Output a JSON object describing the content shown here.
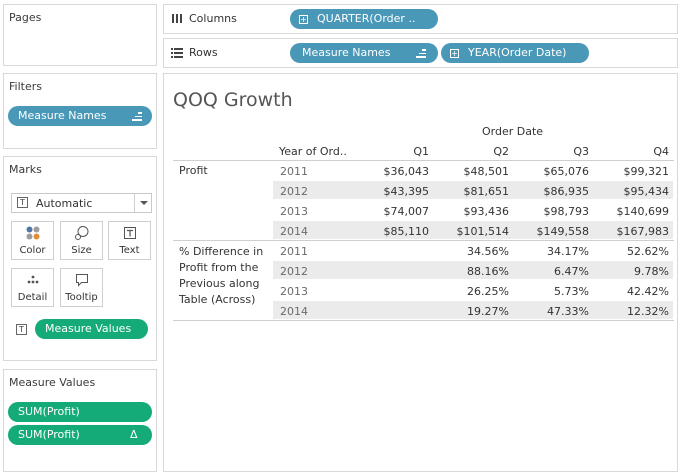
{
  "pages": {
    "title": "Pages"
  },
  "filters": {
    "title": "Filters",
    "pill": "Measure Names"
  },
  "marks": {
    "title": "Marks",
    "mark_type": "Automatic",
    "buttons": [
      {
        "label": "Color",
        "icon": "color-dots-icon"
      },
      {
        "label": "Size",
        "icon": "size-icon"
      },
      {
        "label": "Text",
        "icon": "text-icon"
      },
      {
        "label": "Detail",
        "icon": "detail-icon"
      },
      {
        "label": "Tooltip",
        "icon": "tooltip-icon"
      }
    ],
    "text_pill": "Measure Values"
  },
  "measure_values": {
    "title": "Measure Values",
    "items": [
      {
        "label": "SUM(Profit)",
        "delta": ""
      },
      {
        "label": "SUM(Profit)",
        "delta": "Δ"
      }
    ]
  },
  "columns": {
    "label": "Columns",
    "pill": "QUARTER(Order .."
  },
  "rows": {
    "label": "Rows",
    "pills": [
      "Measure Names",
      "YEAR(Order Date)"
    ]
  },
  "view": {
    "title": "QOQ Growth",
    "order_date_header": "Order Date",
    "year_header": "Year of Ord..",
    "quarters": [
      "Q1",
      "Q2",
      "Q3",
      "Q4"
    ],
    "groups": [
      {
        "label": "Profit",
        "rows": [
          {
            "year": "2011",
            "values": [
              "$36,043",
              "$48,501",
              "$65,076",
              "$99,321"
            ]
          },
          {
            "year": "2012",
            "values": [
              "$43,395",
              "$81,651",
              "$86,935",
              "$95,434"
            ]
          },
          {
            "year": "2013",
            "values": [
              "$74,007",
              "$93,436",
              "$98,793",
              "$140,699"
            ]
          },
          {
            "year": "2014",
            "values": [
              "$85,110",
              "$101,514",
              "$149,558",
              "$167,983"
            ]
          }
        ]
      },
      {
        "label": "% Difference in Profit from the Previous along Table (Across)",
        "label_lines": [
          "% Difference in",
          "Profit from the",
          "Previous along",
          "Table (Across)"
        ],
        "rows": [
          {
            "year": "2011",
            "values": [
              "",
              "34.56%",
              "34.17%",
              "52.62%"
            ]
          },
          {
            "year": "2012",
            "values": [
              "",
              "88.16%",
              "6.47%",
              "9.78%"
            ]
          },
          {
            "year": "2013",
            "values": [
              "",
              "26.25%",
              "5.73%",
              "42.42%"
            ]
          },
          {
            "year": "2014",
            "values": [
              "",
              "19.27%",
              "47.33%",
              "12.32%"
            ]
          }
        ]
      }
    ]
  }
}
